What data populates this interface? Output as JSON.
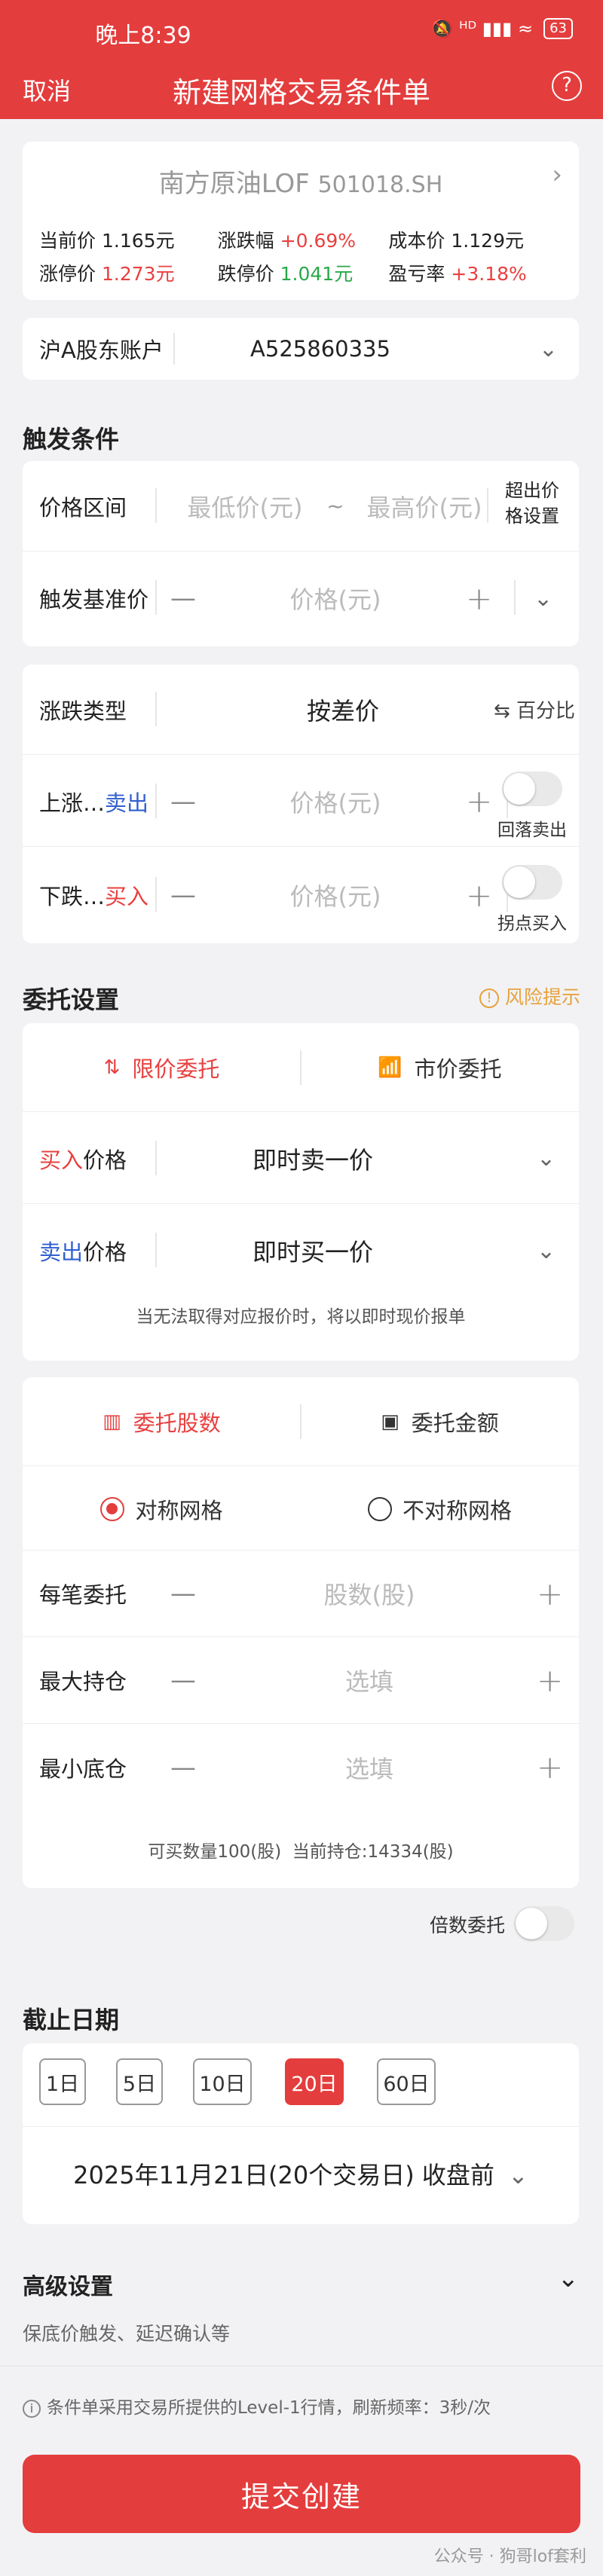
{
  "status": {
    "time": "晚上8:39",
    "icons": "🔕 ᴴᴰ ▮▮▮ ≈",
    "battery": "63"
  },
  "nav": {
    "cancel": "取消",
    "title": "新建网格交易条件单",
    "help": "?"
  },
  "stock": {
    "name": "南方原油LOF",
    "code": "501018.SH",
    "quotes_row1": [
      {
        "label": "当前价",
        "value": "1.165元",
        "color": "dark"
      },
      {
        "label": "涨跌幅",
        "value": "+0.69%",
        "color": "red"
      },
      {
        "label": "成本价",
        "value": "1.129元",
        "color": "dark"
      }
    ],
    "quotes_row2": [
      {
        "label": "涨停价",
        "value": "1.273元",
        "color": "red"
      },
      {
        "label": "跌停价",
        "value": "1.041元",
        "color": "green"
      },
      {
        "label": "盈亏率",
        "value": "+3.18%",
        "color": "red"
      }
    ]
  },
  "account": {
    "label": "沪A股东账户",
    "value": "A525860335"
  },
  "trigger": {
    "section_title": "触发条件",
    "price_range_label": "价格区间",
    "min_placeholder": "最低价(元)",
    "tilde": "~",
    "max_placeholder": "最高价(元)",
    "over_setting": "超出价\n格设置",
    "base_label": "触发基准价",
    "price_placeholder": "价格(元)",
    "change_type_label": "涨跌类型",
    "change_type_value": "按差价",
    "switch_label": "⇆ 百分比",
    "up_label": "上涨…",
    "up_action": "卖出",
    "down_label": "下跌…",
    "down_action": "买入",
    "up_toggle_label": "回落卖出",
    "down_toggle_label": "拐点买入"
  },
  "order": {
    "section_title": "委托设置",
    "risk": "风险提示",
    "tab_limit": "限价委托",
    "tab_market": "市价委托",
    "buy_prefix": "买入",
    "buy_suffix": "价格",
    "buy_value": "即时卖一价",
    "sell_prefix": "卖出",
    "sell_suffix": "价格",
    "sell_value": "即时买一价",
    "note": "当无法取得对应报价时，将以即时现价报单"
  },
  "quantity": {
    "tab_shares": "委托股数",
    "tab_amount": "委托金额",
    "radio_symmetric": "对称网格",
    "radio_asymmetric": "不对称网格",
    "each_label": "每笔委托",
    "each_placeholder": "股数(股)",
    "max_label": "最大持仓",
    "max_placeholder": "选填",
    "min_label": "最小底仓",
    "min_placeholder": "选填",
    "note": "可买数量100(股)  当前持仓:14334(股)"
  },
  "multiple": {
    "label": "倍数委托"
  },
  "deadline": {
    "section_title": "截止日期",
    "days": [
      "1日",
      "5日",
      "10日",
      "20日",
      "60日"
    ],
    "active_index": 3,
    "date_text": "2025年11月21日(20个交易日) 收盘前"
  },
  "advanced": {
    "title": "高级设置",
    "desc": "保底价触发、延迟确认等"
  },
  "footer_note": "条件单采用交易所提供的Level-1行情，刷新频率：3秒/次",
  "submit": "提交创建",
  "watermark": "公众号 · 狗哥lof套利",
  "colors": {
    "accent": "#e43d3d",
    "green": "#2aa84a",
    "blue": "#2f5fd0"
  }
}
